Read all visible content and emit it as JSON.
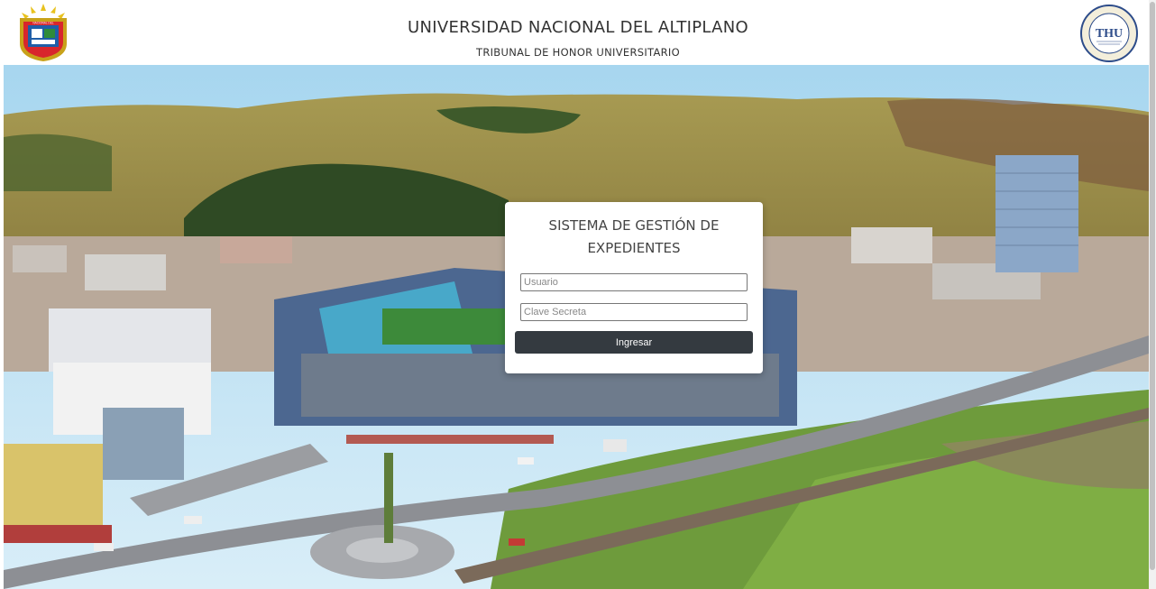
{
  "header": {
    "title": "UNIVERSIDAD NACIONAL DEL ALTIPLANO",
    "subtitle": "TRIBUNAL DE HONOR UNIVERSITARIO",
    "logo_left_text": "NACIONAL DEL",
    "logo_right_text": "THU"
  },
  "login": {
    "title_line1": "SISTEMA DE GESTIÓN DE",
    "title_line2": "EXPEDIENTES",
    "username_placeholder": "Usuario",
    "password_placeholder": "Clave Secreta",
    "submit_label": "Ingresar"
  },
  "colors": {
    "button": "#343a40",
    "header_text": "#333333"
  }
}
